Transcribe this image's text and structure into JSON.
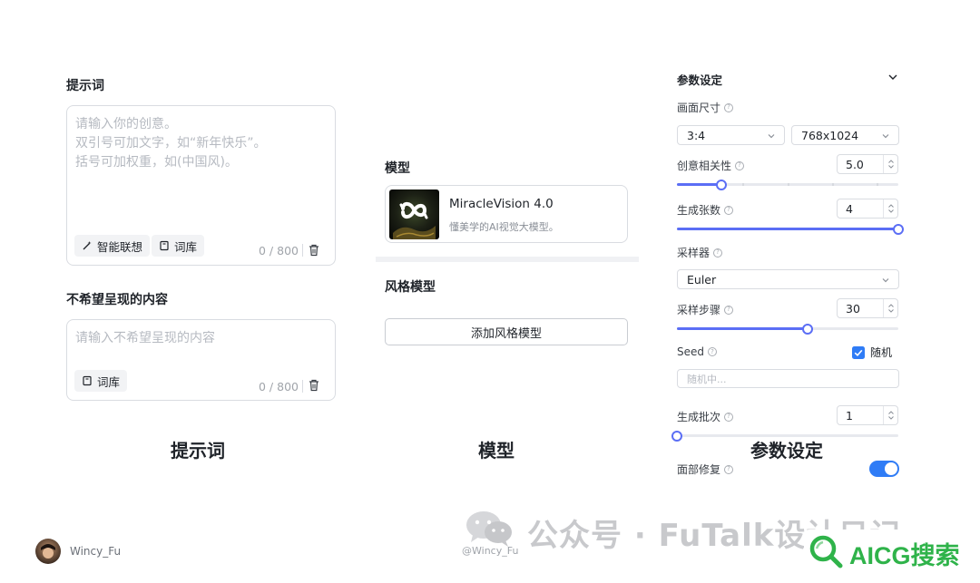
{
  "prompt_section": {
    "title": "提示词",
    "placeholder_lines": [
      "请输入你的创意。",
      "双引号可加文字，如“新年快乐”。",
      "括号可加权重，如(中国风)。"
    ],
    "smart_associate_label": "智能联想",
    "lexicon_label": "词库",
    "counter": "0 / 800"
  },
  "negative_section": {
    "title": "不希望呈现的内容",
    "placeholder": "请输入不希望呈现的内容",
    "lexicon_label": "词库",
    "counter": "0 / 800"
  },
  "model_section": {
    "title": "模型",
    "model_name": "MiracleVision 4.0",
    "model_desc": "懂美学的AI视觉大模型。"
  },
  "style_section": {
    "title": "风格模型",
    "add_button": "添加风格模型"
  },
  "params": {
    "title": "参数设定",
    "size_label": "画面尺寸",
    "ratio_value": "3:4",
    "resolution_value": "768x1024",
    "creativity_label": "创意相关性",
    "creativity_value": "5.0",
    "creativity_fraction": 0.2,
    "count_label": "生成张数",
    "count_value": "4",
    "count_fraction": 1.0,
    "sampler_label": "采样器",
    "sampler_value": "Euler",
    "steps_label": "采样步骤",
    "steps_value": "30",
    "steps_fraction": 0.59,
    "seed_label": "Seed",
    "random_label": "随机",
    "random_checked": true,
    "seed_placeholder": "随机中...",
    "batch_label": "生成批次",
    "batch_value": "1",
    "batch_fraction": 0.0,
    "face_fix_label": "面部修复",
    "face_fix_on": true
  },
  "captions": {
    "prompt": "提示词",
    "model": "模型",
    "params": "参数设定"
  },
  "footer": {
    "author": "Wincy_Fu",
    "handle": "@Wincy_Fu",
    "watermark": "公众号 · FuTalk设计日记",
    "brand": "AICG搜索"
  },
  "colors": {
    "accent": "#5b6ef5",
    "checkbox": "#2f7cf6",
    "brand_green": "#2fb34a"
  }
}
